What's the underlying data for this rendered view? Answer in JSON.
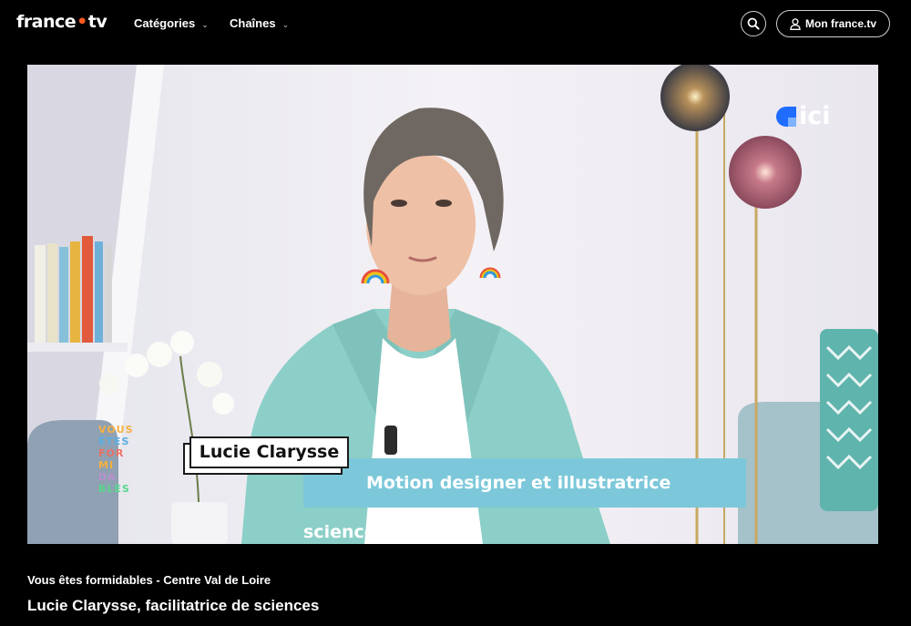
{
  "header": {
    "logo": {
      "part1": "france",
      "dot": "•",
      "part2": "tv"
    },
    "nav": [
      {
        "label": "Catégories",
        "icon": "chevron-down-icon"
      },
      {
        "label": "Chaînes",
        "icon": "chevron-down-icon"
      }
    ],
    "search_icon": "search-icon",
    "account": {
      "label": "Mon france.tv",
      "icon": "user-icon"
    }
  },
  "video": {
    "lower_third_name": "Lucie Clarysse",
    "lower_third_role": "Motion designer et illustratrice science",
    "channel_logo_text": "ici",
    "show_mark_lines": [
      "VOUS",
      "ÊTES",
      "FOR",
      "MI",
      "DA",
      "BLES"
    ]
  },
  "info": {
    "program": "Vous êtes formidables - Centre Val de Loire",
    "episode_title": "Lucie Clarysse, facilitatrice de sciences"
  },
  "colors": {
    "background": "#000000",
    "accent_orange": "#ff5a1f",
    "lower_third_blue": "#7cc8da",
    "ici_blue": "#1f6cff"
  }
}
